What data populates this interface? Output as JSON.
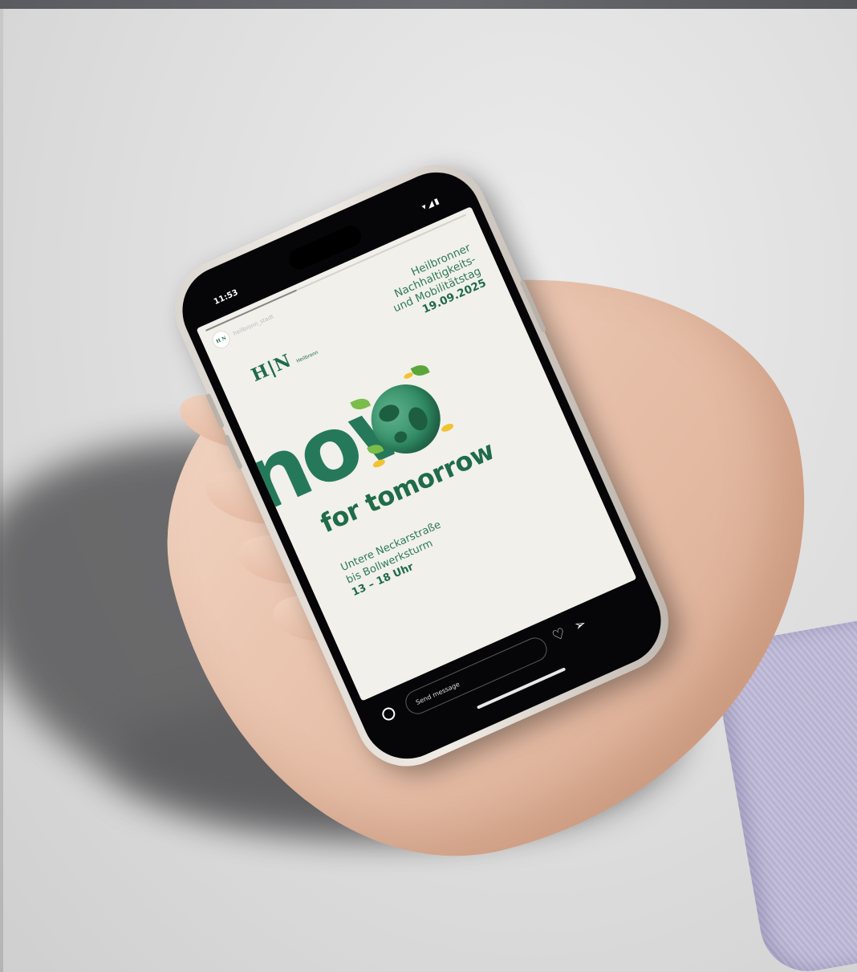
{
  "status_bar": {
    "time": "11:53",
    "icons": "▾◢▮"
  },
  "story": {
    "progress_fraction": 0.35,
    "account_avatar_text": "H N",
    "account_name": "heilbronn_stadt",
    "logo_mark": "H|N",
    "logo_subtitle": "Heilbronn",
    "event_title_lines": [
      "Heilbronner",
      "Nachhaltigkeits-",
      "und Mobilitätstag"
    ],
    "event_date": "19.09.2025",
    "headline": "now",
    "tagline": "for tomorrow",
    "venue_lines": [
      "Untere Neckarstraße",
      "bis Bollwerksturm"
    ],
    "hours": "13 – 18 Uhr"
  },
  "reply_bar": {
    "placeholder": "Send message"
  },
  "icons": [
    "camera-icon",
    "heart-icon",
    "send-icon"
  ],
  "colors": {
    "brand_green": "#1f6b4a",
    "story_background": "#f1f0ea"
  }
}
